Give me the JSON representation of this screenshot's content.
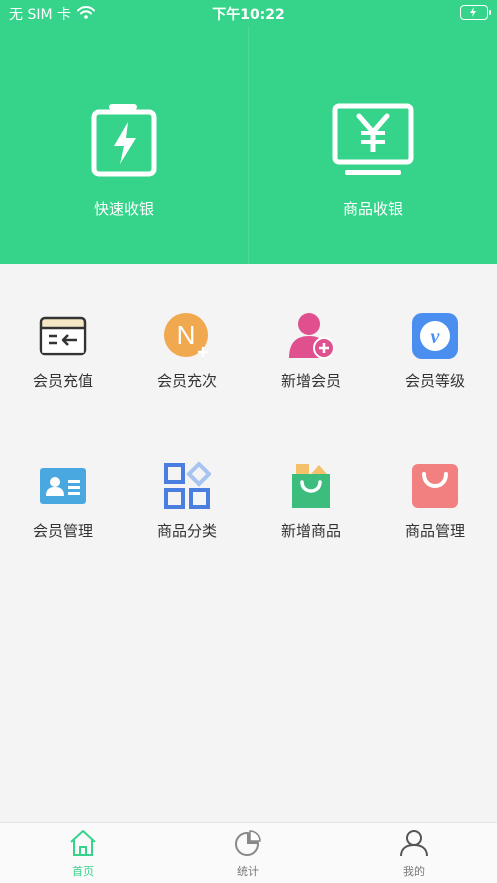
{
  "status_bar": {
    "carrier": "无 SIM 卡",
    "time": "下午10:22"
  },
  "hero": {
    "quick_checkout": {
      "label": "快速收银",
      "icon": "battery-charge-icon"
    },
    "product_checkout": {
      "label": "商品收银",
      "icon": "yen-monitor-icon"
    }
  },
  "grid": {
    "items": [
      {
        "label": "会员充值",
        "icon": "card-recharge-icon",
        "color": "#333333"
      },
      {
        "label": "会员充次",
        "icon": "n-plus-icon",
        "color": "#f0a94f"
      },
      {
        "label": "新增会员",
        "icon": "add-member-icon",
        "color": "#e0508f"
      },
      {
        "label": "会员等级",
        "icon": "vip-level-icon",
        "color": "#4a8ff0"
      },
      {
        "label": "会员管理",
        "icon": "member-card-icon",
        "color": "#4aa8e0"
      },
      {
        "label": "商品分类",
        "icon": "category-grid-icon",
        "color": "#4a7fe0"
      },
      {
        "label": "新增商品",
        "icon": "add-product-bag-icon",
        "color": "#3dbd7d"
      },
      {
        "label": "商品管理",
        "icon": "shopping-bag-icon",
        "color": "#f28080"
      }
    ]
  },
  "tabbar": {
    "tabs": [
      {
        "label": "首页",
        "icon": "home-icon",
        "active": true
      },
      {
        "label": "统计",
        "icon": "pie-chart-icon",
        "active": false
      },
      {
        "label": "我的",
        "icon": "user-icon",
        "active": false
      }
    ]
  },
  "colors": {
    "accent": "#36d48b",
    "background": "#f4f4f4"
  }
}
